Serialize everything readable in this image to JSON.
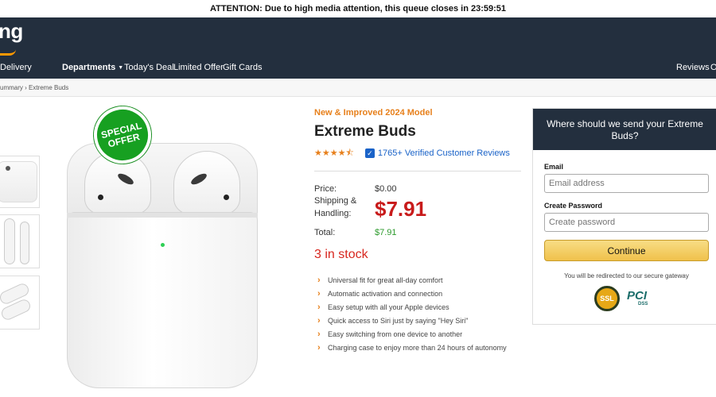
{
  "alert": {
    "text": "ATTENTION: Due to high media attention, this queue closes in 23:59:51"
  },
  "header": {
    "logo_text": "ng"
  },
  "nav": {
    "delivery": "Delivery",
    "departments": "Departments",
    "todays_deal": "Today's Deal",
    "limited_offer": "Limited Offer",
    "gift_cards": "Gift Cards",
    "reviews": "Reviews",
    "overflow": "O"
  },
  "breadcrumb": {
    "text": "ummary › Extreme Buds"
  },
  "badge": {
    "line1": "SPECIAL",
    "line2": "OFFER"
  },
  "product": {
    "promo": "New & Improved 2024 Model",
    "title": "Extreme Buds",
    "stars": "★★★★⯪",
    "reviews_text": "1765+ Verified Customer Reviews",
    "price_label": "Price:",
    "price_value": "$0.00",
    "shipping_label_1": "Shipping &",
    "shipping_label_2": "Handling:",
    "shipping_value": "$7.91",
    "total_label": "Total:",
    "total_value": "$7.91",
    "stock": "3 in stock",
    "features": [
      "Universal fit for great all-day comfort",
      "Automatic activation and connection",
      "Easy setup with all your Apple devices",
      "Quick access to Siri just by saying \"Hey Siri\"",
      "Easy switching from one device to another",
      "Charging case to enjoy more than 24 hours of autonomy"
    ]
  },
  "form": {
    "heading": "Where should we send your Extreme Buds?",
    "email_label": "Email",
    "email_placeholder": "Email address",
    "password_label": "Create Password",
    "password_placeholder": "Create password",
    "button_label": "Continue",
    "secure_note": "You will be redirected to our secure gateway",
    "ssl_seal": "SSL",
    "pci_seal": "PCI",
    "pci_sub": "DSS"
  },
  "icons": {
    "rating": "star-rating-icon",
    "verified": "checkbox-check-icon",
    "feature_bullet": "chevron-right-icon"
  },
  "colors": {
    "header_bg": "#232f3e",
    "accent_orange": "#e7801c",
    "price_red": "#c81b1b",
    "total_green": "#2c9a2c",
    "badge_green": "#17a021",
    "button_yellow": "#f0c14b",
    "link_blue": "#1a63c8"
  }
}
